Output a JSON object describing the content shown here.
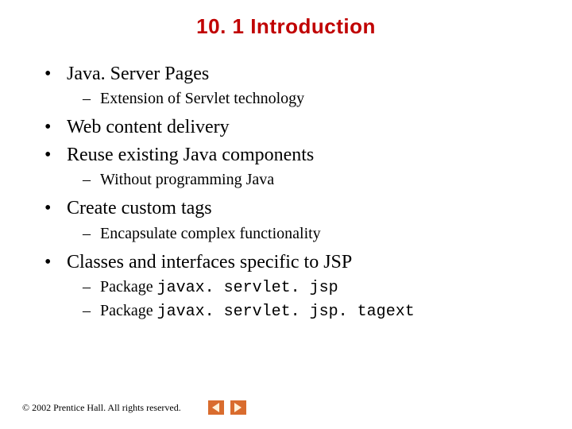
{
  "title": "10. 1   Introduction",
  "bullets": {
    "b1": "Java. Server Pages",
    "b1a": "Extension of Servlet technology",
    "b2": "Web content delivery",
    "b3": "Reuse existing Java components",
    "b3a": "Without programming Java",
    "b4": "Create custom tags",
    "b4a": "Encapsulate complex functionality",
    "b5": "Classes and interfaces specific to JSP",
    "b5a_prefix": "Package ",
    "b5a_code": "javax. servlet. jsp",
    "b5b_prefix": "Package ",
    "b5b_code": "javax. servlet. jsp. tagext"
  },
  "footer": {
    "copyright": "© 2002 Prentice Hall. All rights reserved."
  }
}
